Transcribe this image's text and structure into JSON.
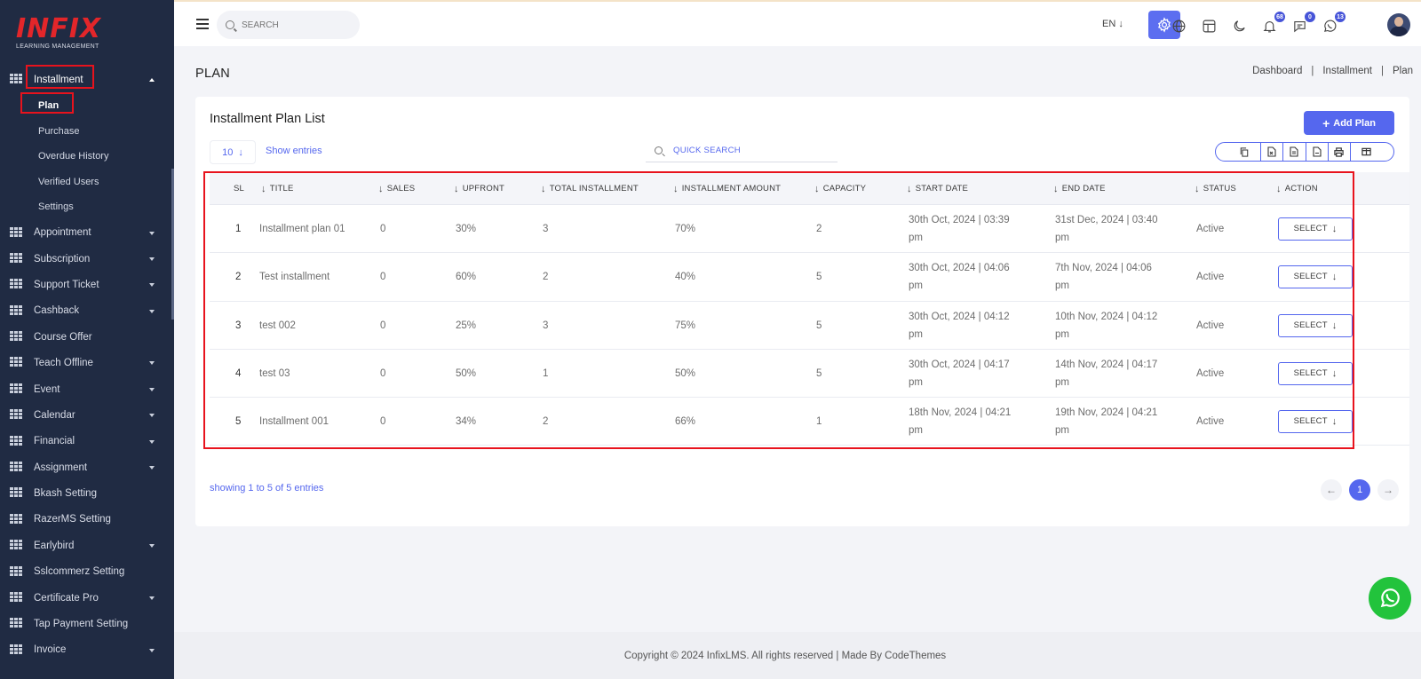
{
  "brand": {
    "logo_text": "INFIX",
    "logo_sub": "LEARNING MANAGEMENT"
  },
  "sidebar": {
    "installment": {
      "label": "Installment",
      "subitems": [
        "Plan",
        "Purchase",
        "Overdue History",
        "Verified Users",
        "Settings"
      ]
    },
    "items": [
      {
        "label": "Appointment",
        "caret": true
      },
      {
        "label": "Subscription",
        "caret": true
      },
      {
        "label": "Support Ticket",
        "caret": true
      },
      {
        "label": "Cashback",
        "caret": true
      },
      {
        "label": "Course Offer",
        "caret": false
      },
      {
        "label": "Teach Offline",
        "caret": true
      },
      {
        "label": "Event",
        "caret": true
      },
      {
        "label": "Calendar",
        "caret": true
      },
      {
        "label": "Financial",
        "caret": true
      },
      {
        "label": "Assignment",
        "caret": true
      },
      {
        "label": "Bkash Setting",
        "caret": false
      },
      {
        "label": "RazerMS Setting",
        "caret": false
      },
      {
        "label": "Earlybird",
        "caret": true
      },
      {
        "label": "Sslcommerz Setting",
        "caret": false
      },
      {
        "label": "Certificate Pro",
        "caret": true
      },
      {
        "label": "Tap Payment Setting",
        "caret": false
      },
      {
        "label": "Invoice",
        "caret": true
      }
    ]
  },
  "topbar": {
    "search_placeholder": "SEARCH",
    "language": "EN ↓",
    "badges": {
      "notifications": "68",
      "messages": "0",
      "whatsapp": "13"
    }
  },
  "page": {
    "title": "PLAN",
    "breadcrumb": [
      "Dashboard",
      "Installment",
      "Plan"
    ]
  },
  "card": {
    "title": "Installment Plan List",
    "add_button": "Add Plan",
    "entries_value": "10",
    "entries_label": "Show entries",
    "quick_search": "QUICK SEARCH",
    "showing": "showing 1 to 5 of 5 entries",
    "current_page": "1"
  },
  "table": {
    "headers": [
      "SL",
      "TITLE",
      "SALES",
      "UPFRONT",
      "TOTAL INSTALLMENT",
      "INSTALLMENT AMOUNT",
      "CAPACITY",
      "START DATE",
      "END DATE",
      "STATUS",
      "ACTION"
    ],
    "rows": [
      {
        "sl": "1",
        "title": "Installment plan 01",
        "sales": "0",
        "upfront": "30%",
        "total": "3",
        "amount": "70%",
        "capacity": "2",
        "start": "30th Oct, 2024 | 03:39 pm",
        "end": "31st Dec, 2024 | 03:40 pm",
        "status": "Active",
        "action": "SELECT"
      },
      {
        "sl": "2",
        "title": "Test installment",
        "sales": "0",
        "upfront": "60%",
        "total": "2",
        "amount": "40%",
        "capacity": "5",
        "start": "30th Oct, 2024 | 04:06 pm",
        "end": "7th Nov, 2024 | 04:06 pm",
        "status": "Active",
        "action": "SELECT"
      },
      {
        "sl": "3",
        "title": "test 002",
        "sales": "0",
        "upfront": "25%",
        "total": "3",
        "amount": "75%",
        "capacity": "5",
        "start": "30th Oct, 2024 | 04:12 pm",
        "end": "10th Nov, 2024 | 04:12 pm",
        "status": "Active",
        "action": "SELECT"
      },
      {
        "sl": "4",
        "title": "test 03",
        "sales": "0",
        "upfront": "50%",
        "total": "1",
        "amount": "50%",
        "capacity": "5",
        "start": "30th Oct, 2024 | 04:17 pm",
        "end": "14th Nov, 2024 | 04:17 pm",
        "status": "Active",
        "action": "SELECT"
      },
      {
        "sl": "5",
        "title": "Installment 001",
        "sales": "0",
        "upfront": "34%",
        "total": "2",
        "amount": "66%",
        "capacity": "1",
        "start": "18th Nov, 2024 | 04:21 pm",
        "end": "19th Nov, 2024 | 04:21 pm",
        "status": "Active",
        "action": "SELECT"
      }
    ]
  },
  "footer": {
    "text": "Copyright © 2024 InfixLMS. All rights reserved | Made By CodeThemes"
  },
  "colors": {
    "sidebar": "#202b43",
    "accent": "#5567ee",
    "highlight": "#e8131d",
    "whatsapp": "#22c33c"
  }
}
